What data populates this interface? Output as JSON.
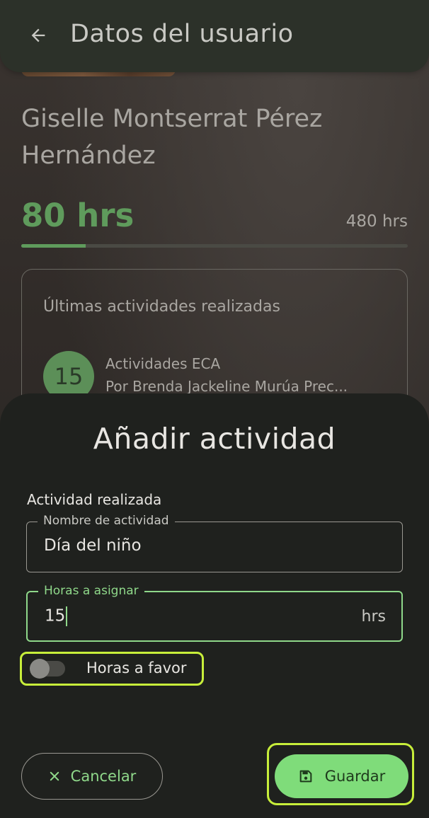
{
  "app_bar": {
    "title": "Datos del usuario",
    "back_icon": "arrow-left-icon"
  },
  "user": {
    "name": "Giselle Montserrat Pérez Hernández",
    "hours_done": "80 hrs",
    "hours_goal": "480 hrs",
    "progress_fraction": 0.1667
  },
  "activities_card": {
    "title": "Últimas actividades realizadas",
    "items": [
      {
        "hours": "15",
        "name": "Actividades ECA",
        "by": "Por Brenda Jackeline Murúa Prec..."
      }
    ]
  },
  "dialog": {
    "title": "Añadir actividad",
    "section_label": "Actividad realizada",
    "name_field": {
      "label": "Nombre de actividad",
      "value": "Día del niño"
    },
    "hours_field": {
      "label": "Horas a asignar",
      "value": "15",
      "suffix": "hrs"
    },
    "toggle": {
      "label": "Horas a favor",
      "on": false
    },
    "cancel_label": "Cancelar",
    "save_label": "Guardar"
  },
  "colors": {
    "accent_green": "#5f9b5c",
    "button_green": "#7fdc7a",
    "highlight": "#c7ee3a",
    "sheet_bg": "#1f211e"
  }
}
